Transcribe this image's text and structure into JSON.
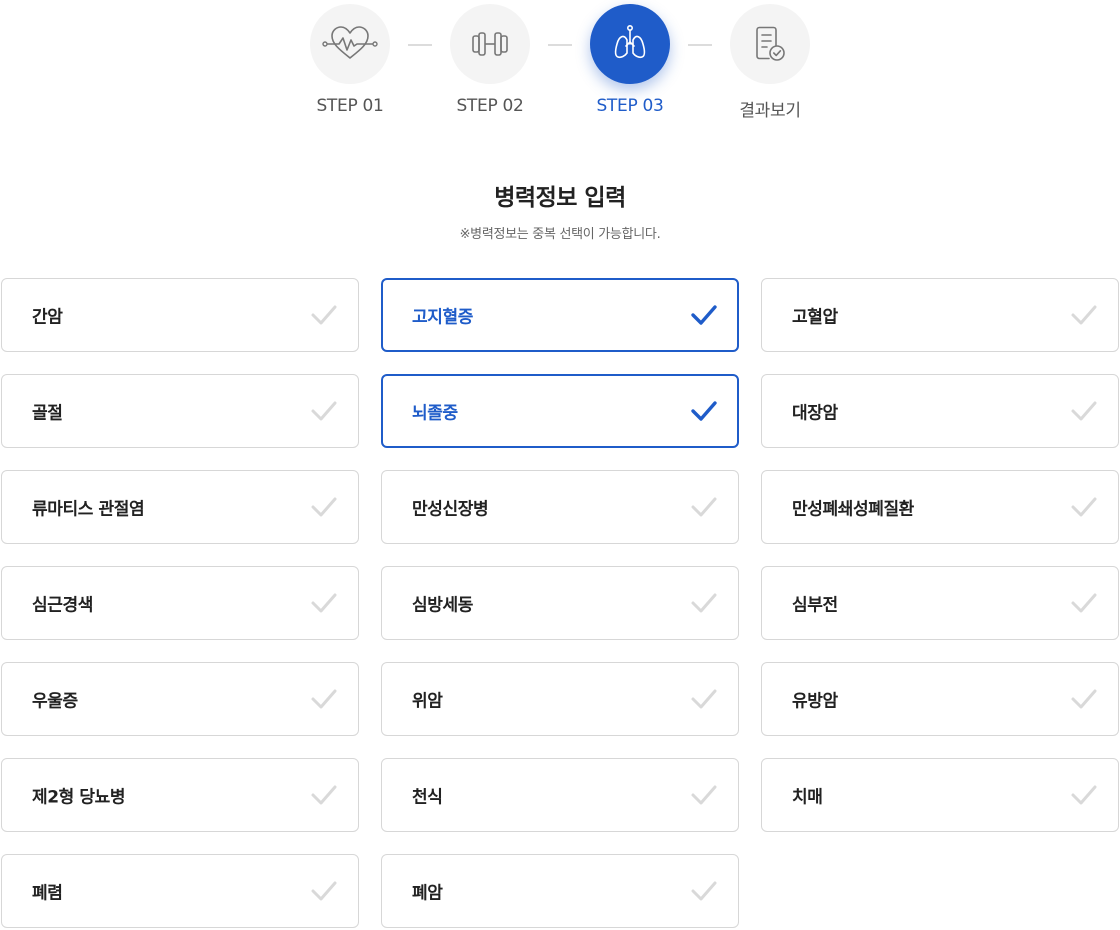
{
  "steps": [
    {
      "label": "STEP 01",
      "icon": "heartbeat-icon",
      "active": false
    },
    {
      "label": "STEP 02",
      "icon": "dumbbell-icon",
      "active": false
    },
    {
      "label": "STEP 03",
      "icon": "lungs-icon",
      "active": true
    },
    {
      "label": "결과보기",
      "icon": "report-check-icon",
      "active": false
    }
  ],
  "section": {
    "title": "병력정보 입력",
    "subtitle": "※병력정보는 중복 선택이 가능합니다."
  },
  "colors": {
    "accent": "#1f5cc9",
    "inactive_check": "#d9d9d9",
    "border": "#d7d7d7",
    "step_bg": "#f4f4f4"
  },
  "conditions": [
    {
      "label": "간암",
      "selected": false
    },
    {
      "label": "고지혈증",
      "selected": true
    },
    {
      "label": "고혈압",
      "selected": false
    },
    {
      "label": "골절",
      "selected": false
    },
    {
      "label": "뇌졸중",
      "selected": true
    },
    {
      "label": "대장암",
      "selected": false
    },
    {
      "label": "류마티스 관절염",
      "selected": false
    },
    {
      "label": "만성신장병",
      "selected": false
    },
    {
      "label": "만성폐쇄성폐질환",
      "selected": false
    },
    {
      "label": "심근경색",
      "selected": false
    },
    {
      "label": "심방세동",
      "selected": false
    },
    {
      "label": "심부전",
      "selected": false
    },
    {
      "label": "우울증",
      "selected": false
    },
    {
      "label": "위암",
      "selected": false
    },
    {
      "label": "유방암",
      "selected": false
    },
    {
      "label": "제2형 당뇨병",
      "selected": false
    },
    {
      "label": "천식",
      "selected": false
    },
    {
      "label": "치매",
      "selected": false
    },
    {
      "label": "폐렴",
      "selected": false
    },
    {
      "label": "폐암",
      "selected": false
    }
  ]
}
